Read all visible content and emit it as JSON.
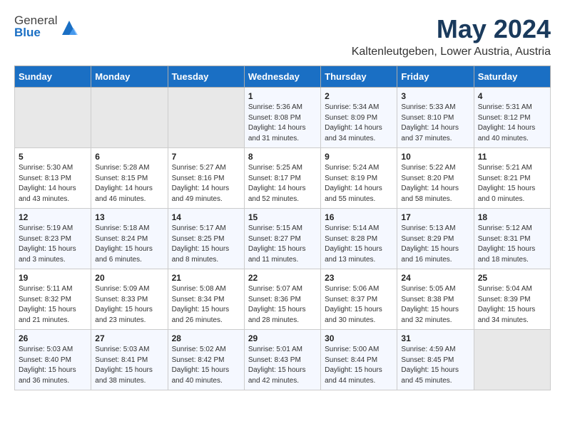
{
  "header": {
    "logo_general": "General",
    "logo_blue": "Blue",
    "month": "May 2024",
    "location": "Kaltenleutgeben, Lower Austria, Austria"
  },
  "weekdays": [
    "Sunday",
    "Monday",
    "Tuesday",
    "Wednesday",
    "Thursday",
    "Friday",
    "Saturday"
  ],
  "weeks": [
    [
      {
        "day": "",
        "info": ""
      },
      {
        "day": "",
        "info": ""
      },
      {
        "day": "",
        "info": ""
      },
      {
        "day": "1",
        "info": "Sunrise: 5:36 AM\nSunset: 8:08 PM\nDaylight: 14 hours\nand 31 minutes."
      },
      {
        "day": "2",
        "info": "Sunrise: 5:34 AM\nSunset: 8:09 PM\nDaylight: 14 hours\nand 34 minutes."
      },
      {
        "day": "3",
        "info": "Sunrise: 5:33 AM\nSunset: 8:10 PM\nDaylight: 14 hours\nand 37 minutes."
      },
      {
        "day": "4",
        "info": "Sunrise: 5:31 AM\nSunset: 8:12 PM\nDaylight: 14 hours\nand 40 minutes."
      }
    ],
    [
      {
        "day": "5",
        "info": "Sunrise: 5:30 AM\nSunset: 8:13 PM\nDaylight: 14 hours\nand 43 minutes."
      },
      {
        "day": "6",
        "info": "Sunrise: 5:28 AM\nSunset: 8:15 PM\nDaylight: 14 hours\nand 46 minutes."
      },
      {
        "day": "7",
        "info": "Sunrise: 5:27 AM\nSunset: 8:16 PM\nDaylight: 14 hours\nand 49 minutes."
      },
      {
        "day": "8",
        "info": "Sunrise: 5:25 AM\nSunset: 8:17 PM\nDaylight: 14 hours\nand 52 minutes."
      },
      {
        "day": "9",
        "info": "Sunrise: 5:24 AM\nSunset: 8:19 PM\nDaylight: 14 hours\nand 55 minutes."
      },
      {
        "day": "10",
        "info": "Sunrise: 5:22 AM\nSunset: 8:20 PM\nDaylight: 14 hours\nand 58 minutes."
      },
      {
        "day": "11",
        "info": "Sunrise: 5:21 AM\nSunset: 8:21 PM\nDaylight: 15 hours\nand 0 minutes."
      }
    ],
    [
      {
        "day": "12",
        "info": "Sunrise: 5:19 AM\nSunset: 8:23 PM\nDaylight: 15 hours\nand 3 minutes."
      },
      {
        "day": "13",
        "info": "Sunrise: 5:18 AM\nSunset: 8:24 PM\nDaylight: 15 hours\nand 6 minutes."
      },
      {
        "day": "14",
        "info": "Sunrise: 5:17 AM\nSunset: 8:25 PM\nDaylight: 15 hours\nand 8 minutes."
      },
      {
        "day": "15",
        "info": "Sunrise: 5:15 AM\nSunset: 8:27 PM\nDaylight: 15 hours\nand 11 minutes."
      },
      {
        "day": "16",
        "info": "Sunrise: 5:14 AM\nSunset: 8:28 PM\nDaylight: 15 hours\nand 13 minutes."
      },
      {
        "day": "17",
        "info": "Sunrise: 5:13 AM\nSunset: 8:29 PM\nDaylight: 15 hours\nand 16 minutes."
      },
      {
        "day": "18",
        "info": "Sunrise: 5:12 AM\nSunset: 8:31 PM\nDaylight: 15 hours\nand 18 minutes."
      }
    ],
    [
      {
        "day": "19",
        "info": "Sunrise: 5:11 AM\nSunset: 8:32 PM\nDaylight: 15 hours\nand 21 minutes."
      },
      {
        "day": "20",
        "info": "Sunrise: 5:09 AM\nSunset: 8:33 PM\nDaylight: 15 hours\nand 23 minutes."
      },
      {
        "day": "21",
        "info": "Sunrise: 5:08 AM\nSunset: 8:34 PM\nDaylight: 15 hours\nand 26 minutes."
      },
      {
        "day": "22",
        "info": "Sunrise: 5:07 AM\nSunset: 8:36 PM\nDaylight: 15 hours\nand 28 minutes."
      },
      {
        "day": "23",
        "info": "Sunrise: 5:06 AM\nSunset: 8:37 PM\nDaylight: 15 hours\nand 30 minutes."
      },
      {
        "day": "24",
        "info": "Sunrise: 5:05 AM\nSunset: 8:38 PM\nDaylight: 15 hours\nand 32 minutes."
      },
      {
        "day": "25",
        "info": "Sunrise: 5:04 AM\nSunset: 8:39 PM\nDaylight: 15 hours\nand 34 minutes."
      }
    ],
    [
      {
        "day": "26",
        "info": "Sunrise: 5:03 AM\nSunset: 8:40 PM\nDaylight: 15 hours\nand 36 minutes."
      },
      {
        "day": "27",
        "info": "Sunrise: 5:03 AM\nSunset: 8:41 PM\nDaylight: 15 hours\nand 38 minutes."
      },
      {
        "day": "28",
        "info": "Sunrise: 5:02 AM\nSunset: 8:42 PM\nDaylight: 15 hours\nand 40 minutes."
      },
      {
        "day": "29",
        "info": "Sunrise: 5:01 AM\nSunset: 8:43 PM\nDaylight: 15 hours\nand 42 minutes."
      },
      {
        "day": "30",
        "info": "Sunrise: 5:00 AM\nSunset: 8:44 PM\nDaylight: 15 hours\nand 44 minutes."
      },
      {
        "day": "31",
        "info": "Sunrise: 4:59 AM\nSunset: 8:45 PM\nDaylight: 15 hours\nand 45 minutes."
      },
      {
        "day": "",
        "info": ""
      }
    ]
  ]
}
